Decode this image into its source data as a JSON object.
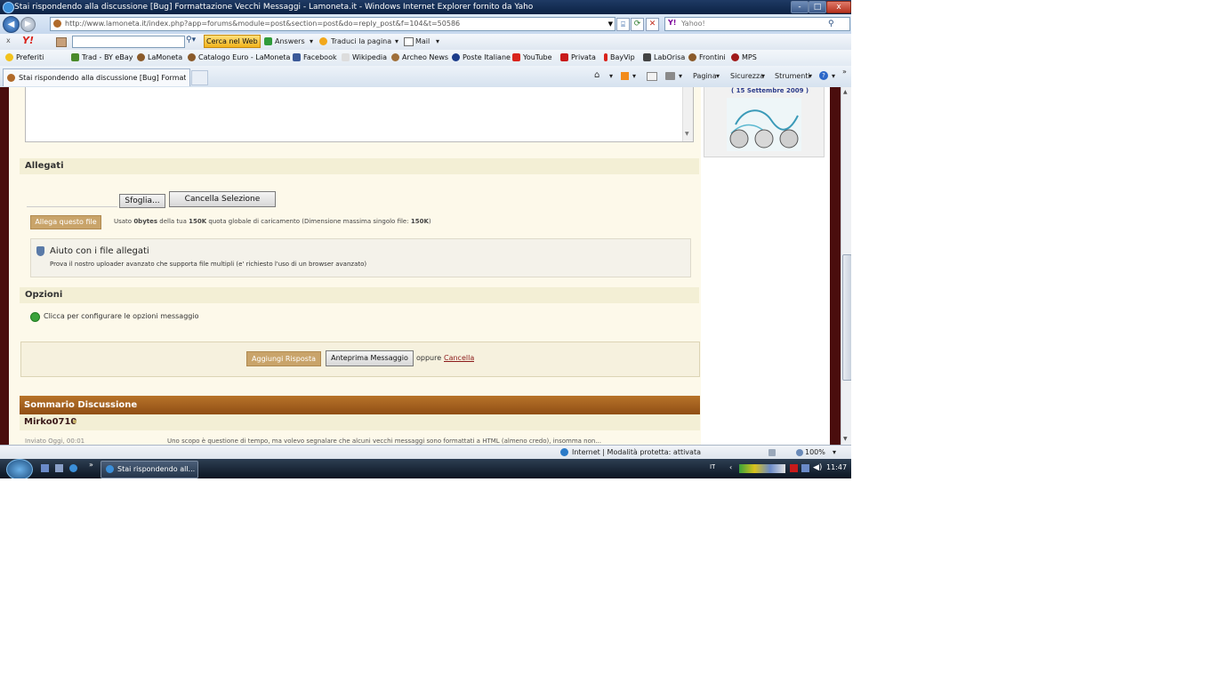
{
  "window": {
    "title": "Stai rispondendo alla discussione [Bug] Formattazione Vecchi Messaggi - Lamoneta.it - Windows Internet Explorer fornito da Yaho",
    "min_label": "-",
    "max_label": "□",
    "close_label": "x"
  },
  "address": {
    "url": "http://www.lamoneta.it/index.php?app=forums&module=post&section=post&do=reply_post&f=104&t=50586",
    "search_placeholder": "Yahoo!"
  },
  "yahoo_toolbar": {
    "close": "x",
    "logo": "Y!",
    "search_button": "Cerca nel Web",
    "answers": "Answers",
    "translate": "Traduci la pagina",
    "mail": "Mail"
  },
  "favorites": {
    "label": "Preferiti",
    "items": [
      "Trad - BY eBay",
      "LaMoneta",
      "Catalogo Euro - LaMoneta",
      "Facebook",
      "Wikipedia",
      "Archeo News",
      "Poste Italiane",
      "YouTube",
      "Privata",
      "BayVip",
      "LabOrisa",
      "Frontini",
      "MPS"
    ]
  },
  "tab": {
    "label": "Stai rispondendo alla discussione [Bug] Formatta..."
  },
  "commandbar": {
    "page": "Pagina",
    "security": "Sicurezza",
    "tools": "Strumenti"
  },
  "page": {
    "banner_date": "( 15 Settembre 2009 )",
    "attachments_title": "Allegati",
    "browse_label": "Sfoglia...",
    "cancel_selection_label": "Cancella Selezione",
    "attach_button": "Allega questo file",
    "quota_prefix": "Usato ",
    "quota_used": "0bytes",
    "quota_mid": " della tua ",
    "quota_total": "150K",
    "quota_text": " quota globale di caricamento (Dimensione massima singolo file: ",
    "quota_max": "150K",
    "quota_end": ")",
    "help_title": "Aiuto con i file allegati",
    "help_text": "Prova il nostro uploader avanzato che supporta file multipli (e' richiesto l'uso di un browser avanzato)",
    "options_title": "Opzioni",
    "options_link": "Clicca per configurare le opzioni messaggio",
    "add_reply_button": "Aggiungi Risposta",
    "preview_button": "Anteprima Messaggio",
    "or_text": "oppure",
    "cancel_link": "Cancella",
    "summary_title": "Sommario Discussione",
    "summary_user": "Mirko0710",
    "summary_meta": "Inviato Oggi, 00:01",
    "summary_preview": "Uno scopo è questione di tempo, ma volevo segnalare che alcuni vecchi messaggi sono formattati a HTML (almeno credo), insomma non..."
  },
  "statusbar": {
    "zone": "Internet | Modalità protetta: attivata",
    "zoom": "100%"
  },
  "taskbar": {
    "task_label": "Stai rispondendo all...",
    "clock": "11:47",
    "lang": "IT"
  },
  "colors": {
    "dark_red": "#4a0d0d",
    "cream": "#fdf9ea",
    "tan_button": "#c9a46a",
    "summary_bar": "#a5621f",
    "link_red": "#8b1a1a"
  }
}
